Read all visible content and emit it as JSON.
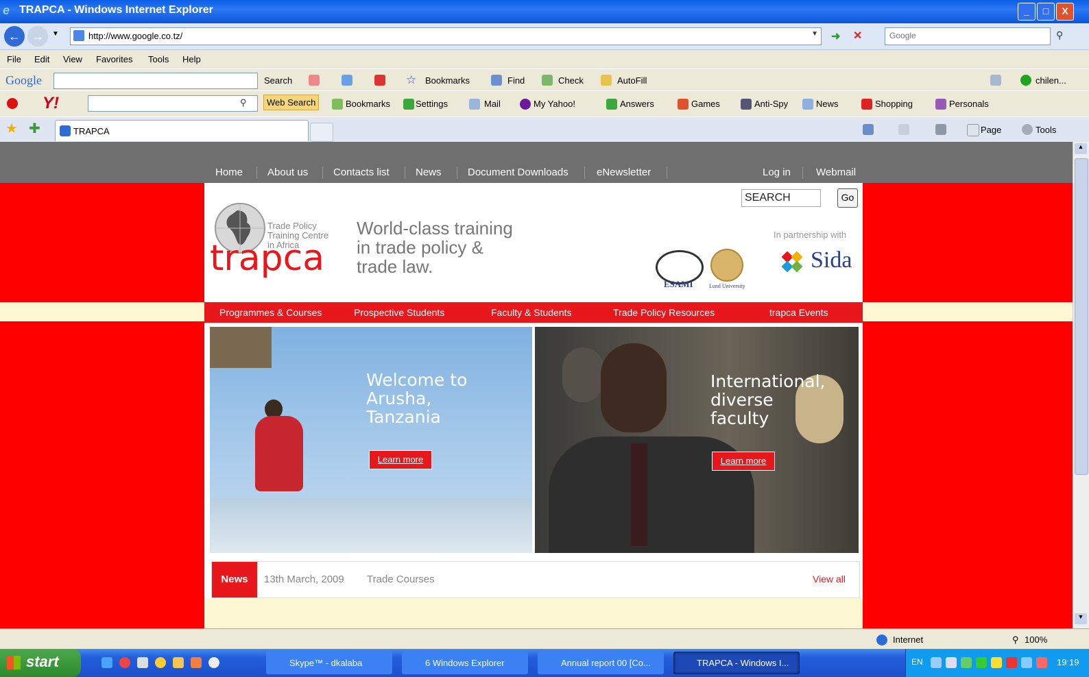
{
  "window": {
    "title": "TRAPCA - Windows Internet Explorer",
    "min": "_",
    "max": "□",
    "close": "X"
  },
  "addressbar": {
    "url": "http://www.google.co.tz/",
    "search_placeholder": "Google"
  },
  "menu": [
    "File",
    "Edit",
    "View",
    "Favorites",
    "Tools",
    "Help"
  ],
  "google_toolbar": {
    "logo": "Google",
    "search": "Search",
    "bookmarks": "Bookmarks",
    "find": "Find",
    "check": "Check",
    "autofill": "AutoFill",
    "user": "chilen..."
  },
  "yahoo_toolbar": {
    "web_search": "Web Search",
    "bookmarks": "Bookmarks",
    "settings": "Settings",
    "mail": "Mail",
    "my_yahoo": "My Yahoo!",
    "answers": "Answers",
    "games": "Games",
    "anti_spy": "Anti-Spy",
    "news": "News",
    "shopping": "Shopping",
    "personals": "Personals"
  },
  "tabbar": {
    "tab_label": "TRAPCA",
    "page": "Page",
    "tools": "Tools"
  },
  "site": {
    "top_nav": [
      "Home",
      "About us",
      "Contacts list",
      "News",
      "Document Downloads",
      "eNewsletter"
    ],
    "login": "Log in",
    "webmail": "Webmail",
    "search_value": "SEARCH",
    "go": "Go",
    "logo": {
      "word": "trapca",
      "line1": "Trade Policy",
      "line2": "Training Centre",
      "line3": "in Africa"
    },
    "tagline": [
      "World-class training",
      "in trade policy &",
      "trade law."
    ],
    "partnership": "In partnership with",
    "partners": {
      "esami": "ESAMI",
      "lund": "Lund University",
      "sida": "Sida"
    },
    "red_menu": [
      "Programmes & Courses",
      "Prospective Students",
      "Faculty & Students",
      "Trade Policy Resources",
      "trapca Events"
    ],
    "hero1": {
      "lines": [
        "Welcome to",
        "Arusha,",
        "Tanzania"
      ],
      "button": "Learn more"
    },
    "hero2": {
      "lines": [
        "International,",
        "diverse",
        "faculty"
      ],
      "button": "Learn more"
    },
    "news": {
      "label": "News",
      "date": "13th March, 2009",
      "headline": "Trade Courses",
      "view_all": "View all"
    }
  },
  "statusbar": {
    "zone": "Internet",
    "zoom": "100%"
  },
  "taskbar": {
    "start": "start",
    "tasks": [
      "Skype™ - dkalaba",
      "6 Windows Explorer",
      "Annual report 00 [Co...",
      "TRAPCA - Windows I..."
    ],
    "lang": "EN",
    "time": "19:19"
  },
  "colors": {
    "site_red": "#e8171c",
    "nav_gray": "#6f6f6f",
    "cream": "#fdf8d3"
  }
}
